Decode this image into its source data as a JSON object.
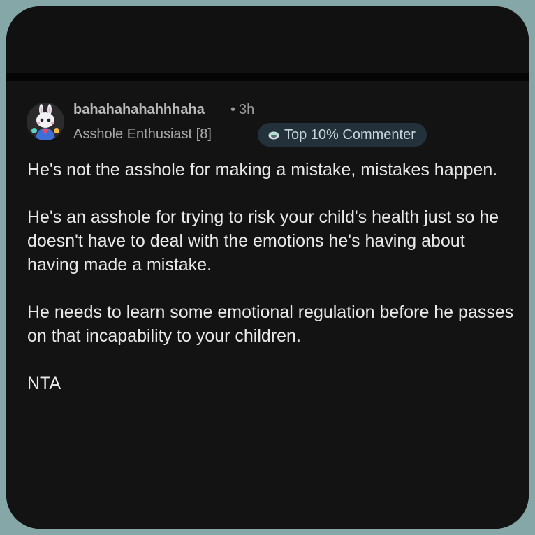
{
  "comment": {
    "author": "bahahahahahhhaha",
    "separator": "•",
    "timestamp": "3h",
    "flair": "Asshole Enthusiast [8]",
    "badge_label": "Top 10% Commenter",
    "badge_icon": "commenter-badge-icon",
    "avatar_icon": "avatar-icon",
    "paragraphs": [
      "He's not the asshole for making a mistake, mistakes happen.",
      "He's an asshole for trying to risk your child's health just so he doesn't have to deal with the emotions he's having about having made a mistake.",
      "He needs to learn some emotional regulation before he passes on that incapability to your children.",
      "NTA"
    ]
  },
  "colors": {
    "background_outer": "#86a7a8",
    "panel": "#131313",
    "badge_bg": "#22313a",
    "text_primary": "#e9e9e9",
    "text_muted": "#9a9a9a"
  }
}
